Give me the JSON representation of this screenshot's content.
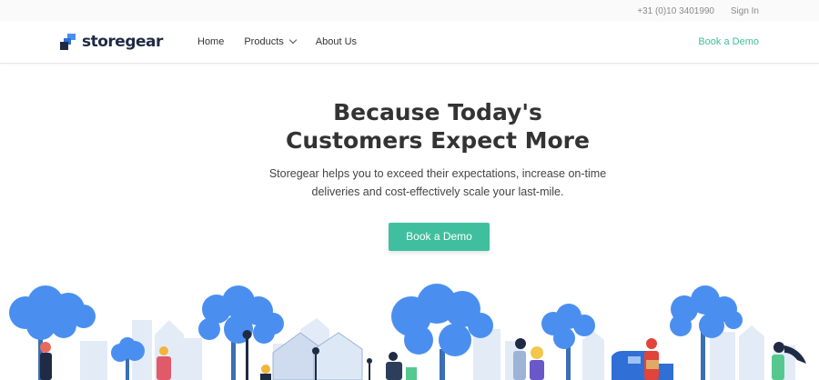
{
  "topbar": {
    "phone": "+31 (0)10 3401990",
    "signin": "Sign In"
  },
  "nav": {
    "logo_text": "storegear",
    "links": [
      "Home",
      "Products",
      "About Us"
    ],
    "cta": "Book a Demo"
  },
  "hero": {
    "title_line1": "Because Today's",
    "title_line2": "Customers Expect More",
    "subtitle_line1": "Storegear helps you to exceed their expectations, increase on-time",
    "subtitle_line2": "deliveries and cost-effectively scale your last-mile.",
    "cta": "Book a Demo"
  },
  "colors": {
    "accent": "#40bf9f",
    "brand_dark": "#1f2a44",
    "tree_blue": "#4a8ff0",
    "building": "#dce6f5"
  },
  "icons": [
    "chevron-down-icon",
    "storegear-logo-icon"
  ]
}
